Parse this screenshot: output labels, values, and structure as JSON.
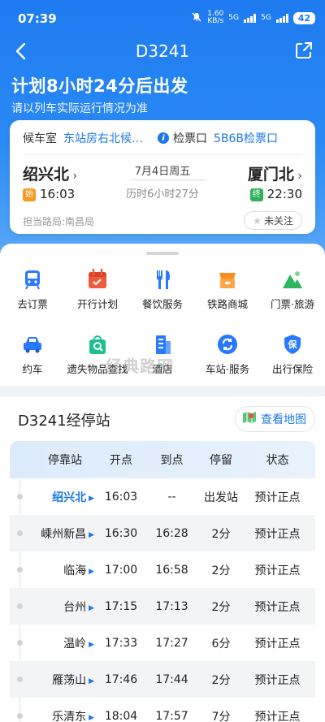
{
  "status": {
    "time": "07:39",
    "speed": "1.60\nKB/s",
    "net1": "5G",
    "net2": "5G",
    "battery": "42"
  },
  "nav": {
    "title": "D3241"
  },
  "header": {
    "headline": "计划8小时24分后出发",
    "subline": "请以列车实际运行情况为准"
  },
  "card": {
    "waiting_label": "候车室",
    "waiting_value": "东站房右北候…",
    "gate_label": "检票口",
    "gate_value": "5B6B检票口",
    "from_station": "绍兴北",
    "to_station": "厦门北",
    "from_tag": "始",
    "to_tag": "终",
    "depart_time": "16:03",
    "arrive_time": "22:30",
    "date": "7月4日周五",
    "duration": "历时6小时27分",
    "bureau": "担当路局:南昌局",
    "follow": "未关注",
    "colors": {
      "start_tag": "#f59a23",
      "end_tag": "#2fb35a",
      "accent": "#1e78e6"
    }
  },
  "services": [
    {
      "label": "去订票",
      "icon": "train-icon"
    },
    {
      "label": "开行计划",
      "icon": "calendar-icon"
    },
    {
      "label": "餐饮服务",
      "icon": "dining-icon"
    },
    {
      "label": "铁路商城",
      "icon": "mall-icon"
    },
    {
      "label": "门票·旅游",
      "icon": "mountain-icon"
    },
    {
      "label": "约车",
      "icon": "car-icon"
    },
    {
      "label": "遗失物品查找",
      "icon": "lost-bag-icon"
    },
    {
      "label": "酒店",
      "icon": "hotel-icon"
    },
    {
      "label": "车站·服务",
      "icon": "station-service-icon"
    },
    {
      "label": "出行保险",
      "icon": "insurance-icon"
    }
  ],
  "stops": {
    "title": "D3241经停站",
    "map_button": "查看地图",
    "headers": [
      "停靠站",
      "开点",
      "到点",
      "停留",
      "状态"
    ],
    "rows": [
      {
        "station": "绍兴北",
        "depart": "16:03",
        "arrive": "--",
        "stay": "出发站",
        "status": "预计正点"
      },
      {
        "station": "嵊州新昌",
        "depart": "16:30",
        "arrive": "16:28",
        "stay": "2分",
        "status": "预计正点"
      },
      {
        "station": "临海",
        "depart": "17:00",
        "arrive": "16:58",
        "stay": "2分",
        "status": "预计正点"
      },
      {
        "station": "台州",
        "depart": "17:15",
        "arrive": "17:13",
        "stay": "2分",
        "status": "预计正点"
      },
      {
        "station": "温岭",
        "depart": "17:33",
        "arrive": "17:27",
        "stay": "6分",
        "status": "预计正点"
      },
      {
        "station": "雁荡山",
        "depart": "17:46",
        "arrive": "17:44",
        "stay": "2分",
        "status": "预计正点"
      },
      {
        "station": "乐清东",
        "depart": "18:04",
        "arrive": "17:57",
        "stay": "7分",
        "status": "预计正点"
      }
    ]
  },
  "watermark": "经典路网"
}
